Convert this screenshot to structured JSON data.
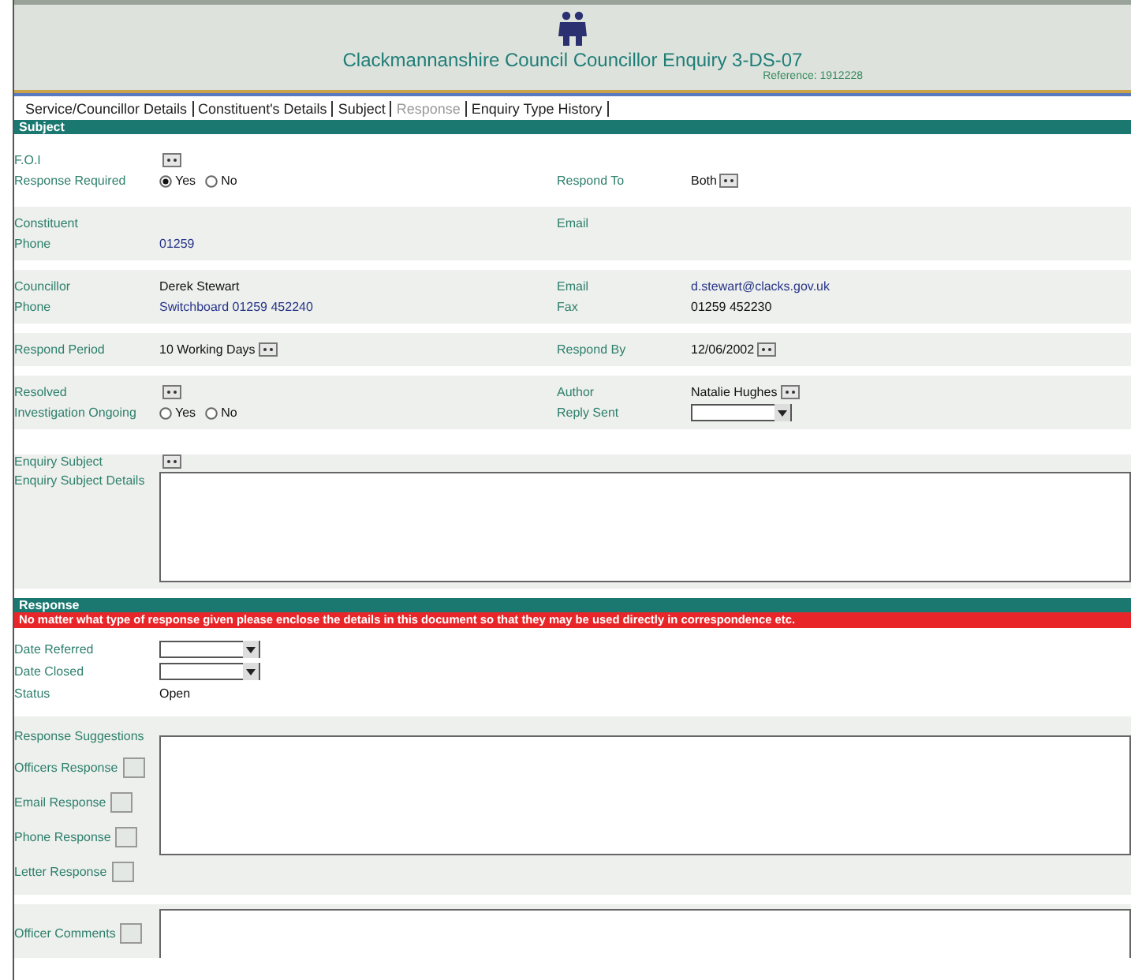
{
  "header": {
    "title": "Clackmannanshire Council Councillor Enquiry 3-DS-07",
    "reference": "Reference: 1912228"
  },
  "tabs": [
    {
      "label": "Service/Councillor Details",
      "selected": false
    },
    {
      "label": "Constituent's Details",
      "selected": false
    },
    {
      "label": "Subject",
      "selected": false
    },
    {
      "label": "Response",
      "selected": true
    },
    {
      "label": "Enquiry Type History",
      "selected": false
    }
  ],
  "subject": {
    "title": "Subject",
    "bands": [
      {
        "shaded": false,
        "rows": [
          [
            {
              "label": "F.O.I",
              "kind": "lookup"
            },
            null
          ],
          [
            {
              "label": "Response Required",
              "kind": "radios",
              "options": [
                {
                  "label": "Yes",
                  "selected": true
                },
                {
                  "label": "No",
                  "selected": false
                }
              ]
            },
            {
              "label": "Respond To",
              "kind": "lookup",
              "value": "Both"
            }
          ]
        ]
      },
      {
        "shaded": true,
        "rows": [
          [
            {
              "label": "Constituent"
            },
            {
              "label": "Email"
            }
          ],
          [
            {
              "label": "Phone",
              "kind": "link",
              "value": "01259"
            },
            null
          ]
        ]
      },
      {
        "shaded": true,
        "rows": [
          [
            {
              "label": "Councillor",
              "kind": "text",
              "value": "Derek Stewart"
            },
            {
              "label": "Email",
              "kind": "link",
              "value": "d.stewart@clacks.gov.uk"
            }
          ],
          [
            {
              "label": "Phone",
              "kind": "link",
              "value": "Switchboard 01259 452240"
            },
            {
              "label": "Fax",
              "kind": "text",
              "value": "01259 452230"
            }
          ]
        ]
      },
      {
        "shaded": true,
        "rows": [
          [
            {
              "label": "Respond Period",
              "kind": "lookup",
              "value": "10 Working Days"
            },
            {
              "label": "Respond By",
              "kind": "lookup",
              "value": "12/06/2002"
            }
          ]
        ]
      },
      {
        "shaded": true,
        "rows": [
          [
            {
              "label": "Resolved",
              "kind": "lookup"
            },
            {
              "label": "Author",
              "kind": "lookup",
              "value": "Natalie Hughes"
            }
          ],
          [
            {
              "label": "Investigation Ongoing",
              "kind": "radios",
              "options": [
                {
                  "label": "Yes",
                  "selected": false
                },
                {
                  "label": "No",
                  "selected": false
                }
              ]
            },
            {
              "label": "Reply Sent",
              "kind": "dropdown"
            }
          ]
        ]
      }
    ],
    "enquiry_subject": {
      "label": "Enquiry Subject"
    },
    "details": {
      "label": "Enquiry Subject Details"
    }
  },
  "response": {
    "title": "Response",
    "notice": "No matter what type of response given please enclose the details in this document so that they may be used directly in correspondence etc.",
    "rows": [
      {
        "label": "Date Referred",
        "kind": "dropdown"
      },
      {
        "label": "Date Closed",
        "kind": "dropdown"
      },
      {
        "label": "Status",
        "kind": "text",
        "value": "Open"
      }
    ],
    "suggestions": {
      "label": "Response Suggestions",
      "buttons": [
        {
          "label": "Officers Response"
        },
        {
          "label": "Email Response"
        },
        {
          "label": "Phone Response"
        },
        {
          "label": "Letter Response"
        }
      ]
    },
    "comments": {
      "label": "Officer Comments"
    }
  }
}
